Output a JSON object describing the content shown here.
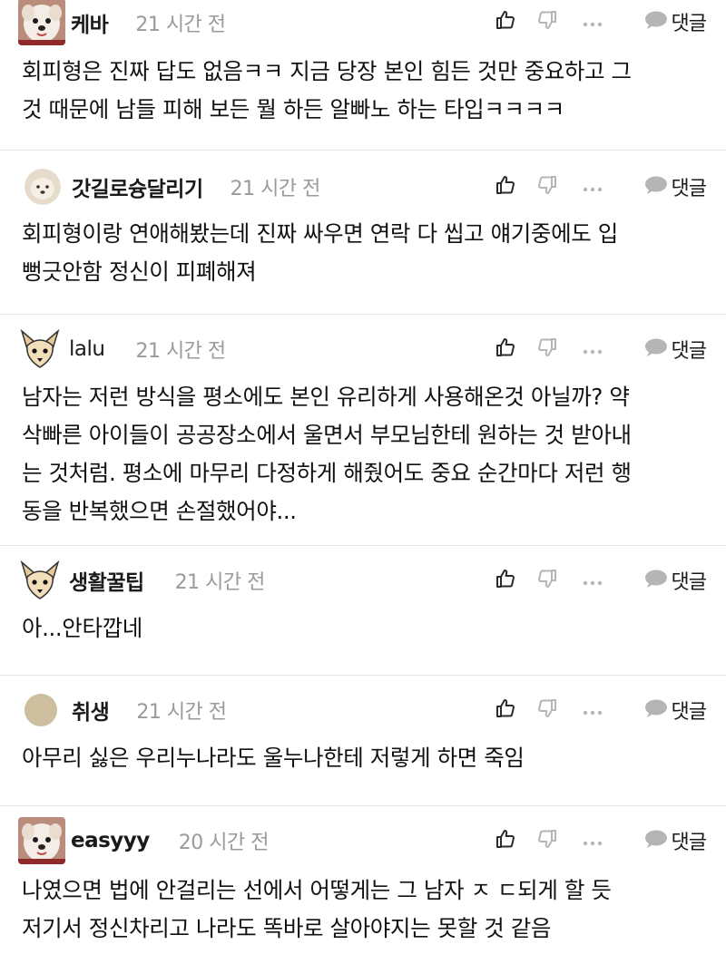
{
  "comments": [
    {
      "nick": "케바",
      "time": "21 시간 전",
      "avatar_icon": "dog-photo-avatar",
      "reply_label": "댓글",
      "lines": [
        "회피형은 진짜 답도 없음ㅋㅋ 지금 당장 본인 힘든 것만 중요하고 그",
        "것 때문에 남들 피해 보든 뭘 하든 알빠노 하는 타입ㅋㅋㅋㅋ"
      ]
    },
    {
      "nick": "갓길로슝달리기",
      "time": "21 시간 전",
      "avatar_icon": "puppy-avatar",
      "reply_label": "댓글",
      "lines": [
        "회피형이랑 연애해봤는데 진짜 싸우면 연락 다 씹고 얘기중에도 입",
        "뻥긋안함 정신이 피폐해져"
      ]
    },
    {
      "nick": "lalu",
      "time": "21 시간 전",
      "avatar_icon": "chihuahua-avatar",
      "reply_label": "댓글",
      "lines": [
        "남자는 저런 방식을 평소에도 본인 유리하게 사용해온것 아닐까? 약",
        "삭빠른 아이들이 공공장소에서 울면서 부모님한테 원하는 것 받아내",
        "는 것처럼. 평소에 마무리 다정하게 해줬어도 중요 순간마다 저런 행",
        "동을 반복했으면 손절했어야..."
      ]
    },
    {
      "nick": "생활꿀팁",
      "time": "21 시간 전",
      "avatar_icon": "chihuahua-avatar",
      "reply_label": "댓글",
      "lines": [
        "아...안타깝네"
      ]
    },
    {
      "nick": "취생",
      "time": "21 시간 전",
      "avatar_icon": "beige-circle-avatar",
      "reply_label": "댓글",
      "lines": [
        "아무리 싫은 우리누나라도 울누나한테 저렇게 하면 죽임"
      ]
    },
    {
      "nick": "easyyy",
      "time": "20 시간 전",
      "avatar_icon": "dog-photo-avatar",
      "reply_label": "댓글",
      "lines": [
        "나였으면 법에 안걸리는 선에서 어떻게는 그 남자 ㅈ ㄷ되게 할 듯",
        "저기서 정신차리고 나라도 똑바로 살아야지는 못할 것 같음"
      ]
    }
  ],
  "icons": {
    "like": "thumbs-up-icon",
    "dislike": "thumbs-down-icon",
    "more": "more-dots-icon",
    "reply": "speech-bubble-icon"
  },
  "colors": {
    "text": "#1a1a1a",
    "time": "#9a9a9a",
    "icon_dark": "#2b2b2b",
    "icon_light": "#b5b5b5",
    "divider": "#e6e6e6"
  }
}
